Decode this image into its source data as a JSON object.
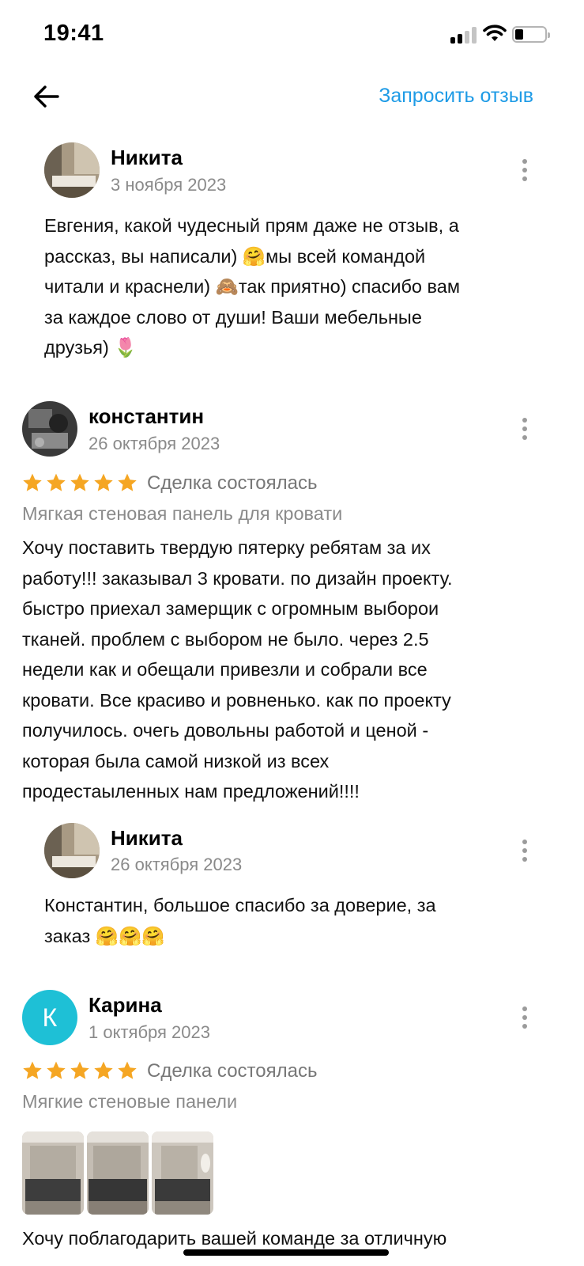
{
  "status_bar": {
    "time": "19:41"
  },
  "nav": {
    "request_review": "Запросить отзыв"
  },
  "reply1": {
    "author": "Никита",
    "date": "3 ноября 2023",
    "lines": [
      "Евгения, какой чудесный прям даже не отзыв, а",
      "рассказ, вы написали) 🤗мы всей командой",
      "читали и краснели) 🙈так приятно) спасибо вам",
      "за каждое слово от души! Ваши мебельные",
      "друзья) 🌷"
    ]
  },
  "review1": {
    "author": "константин",
    "date": "26 октября 2023",
    "rating": 5,
    "deal_status": "Сделка состоялась",
    "product": "Мягкая стеновая панель для кровати",
    "lines": [
      "Хочу поставить твердую пятерку ребятам за их",
      "работу!!! заказывал 3 кровати. по дизайн проекту.",
      "быстро приехал замерщик с огромным выборои",
      "тканей. проблем с выбором не было. через 2.5",
      "недели как и обещали привезли и собрали все",
      "кровати. Все красиво и ровненько. как по проекту",
      "получилось. очегь довольны работой и ценой -",
      "которая была самой низкой из всех",
      "продестаыленных нам предложений!!!!"
    ]
  },
  "reply2": {
    "author": "Никита",
    "date": "26 октября 2023",
    "lines": [
      "Константин, большое спасибо за доверие, за",
      "заказ 🤗🤗🤗"
    ]
  },
  "review2": {
    "author": "Карина",
    "avatar_letter": "К",
    "avatar_color": "#1ec0d6",
    "date": "1 октября 2023",
    "rating": 5,
    "deal_status": "Сделка состоялась",
    "product": "Мягкие стеновые панели",
    "text_start": "Хочу поблагодарить вашей команде за отличную"
  },
  "colors": {
    "accent": "#1e9be6",
    "star": "#f5a623"
  }
}
